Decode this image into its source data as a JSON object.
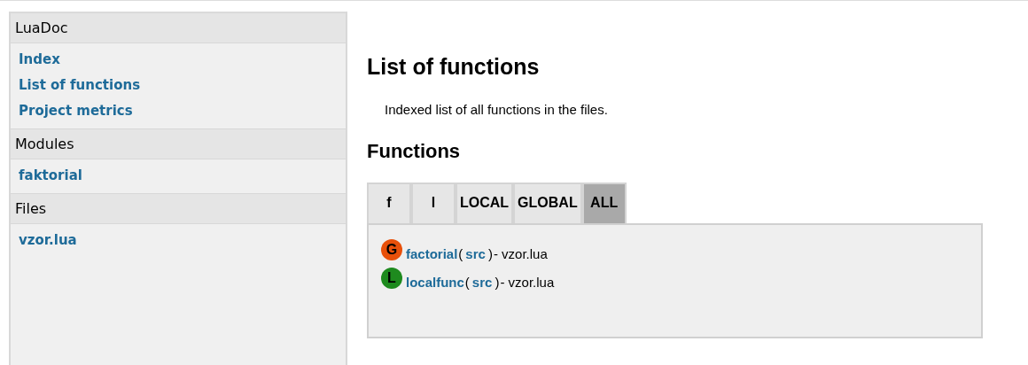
{
  "sidebar": {
    "sections": [
      {
        "title": "LuaDoc",
        "items": [
          "Index",
          "List of functions",
          "Project metrics"
        ]
      },
      {
        "title": "Modules",
        "items": [
          "faktorial"
        ]
      },
      {
        "title": "Files",
        "items": [
          "vzor.lua"
        ]
      }
    ]
  },
  "main": {
    "title": "List of functions",
    "description": "Indexed list of all functions in the files.",
    "heading": "Functions",
    "tabs": [
      {
        "label": "f",
        "selected": false
      },
      {
        "label": "l",
        "selected": false
      },
      {
        "label": "LOCAL",
        "selected": false
      },
      {
        "label": "GLOBAL",
        "selected": false
      },
      {
        "label": "ALL",
        "selected": true
      }
    ],
    "functions": [
      {
        "badge": "G",
        "color": "#e8500a",
        "name": "factorial",
        "open": "(",
        "src": "src",
        "close": ")",
        "file": "- vzor.lua"
      },
      {
        "badge": "L",
        "color": "#1e8a1e",
        "name": "localfunc",
        "open": "(",
        "src": "src",
        "close": ")",
        "file": "- vzor.lua"
      }
    ]
  }
}
